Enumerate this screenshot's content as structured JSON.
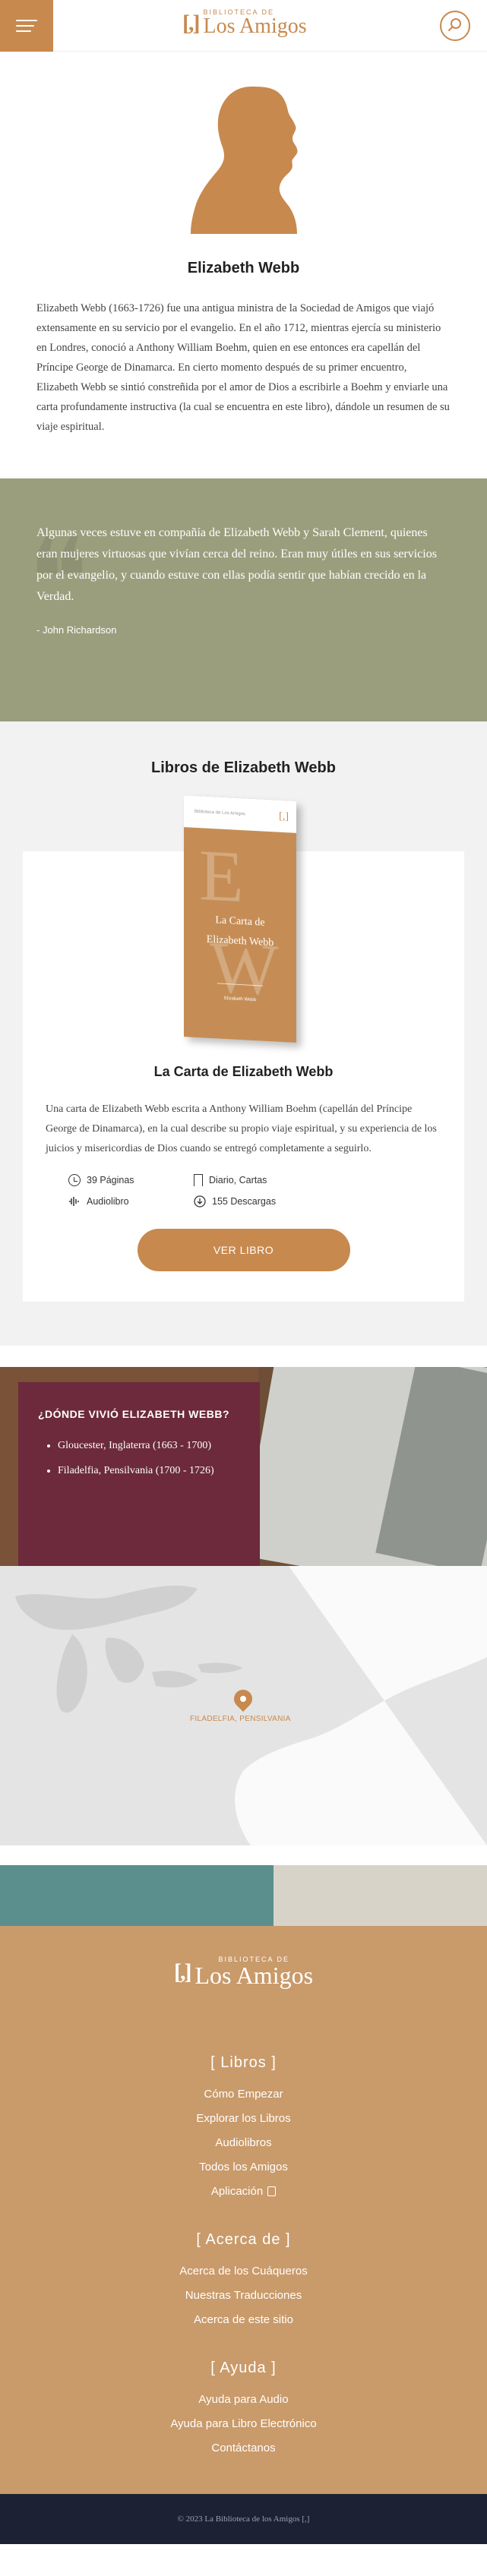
{
  "header": {
    "logo_mark": "[,]",
    "logo_small": "BIBLIOTECA DE",
    "logo_big": "Los Amigos"
  },
  "author": {
    "name": "Elizabeth Webb",
    "bio": "Elizabeth Webb (1663-1726) fue una antigua ministra de la Sociedad de Amigos que viajó extensamente en su servicio por el evangelio. En el año 1712, mientras ejercía su ministerio en Londres, conoció a Anthony William Boehm, quien en ese entonces era capellán del Príncipe George de Dinamarca. En cierto momento después de su primer encuentro, Elizabeth Webb se sintió constreñida por el amor de Dios a escribirle a Boehm y enviarle una carta profundamente instructiva (la cual se encuentra en este libro), dándole un resumen de su viaje espiritual."
  },
  "quote": {
    "text": "Algunas veces estuve en compañía de Elizabeth Webb y Sarah Clement, quienes eran mujeres virtuosas que vivían cerca del reino. Eran muy útiles en sus servicios por el evangelio, y cuando estuve con ellas podía sentir que habían crecido en la Verdad.",
    "author": "- John Richardson"
  },
  "books": {
    "section_title": "Libros de Elizabeth Webb",
    "cover": {
      "top_text": "Biblioteca de Los Amigos",
      "top_mark": "[,]",
      "letter_e": "E",
      "letter_w": "W",
      "title_line1": "La Carta de",
      "title_line2": "Elizabeth Webb",
      "author": "Elizabeth Webb"
    },
    "title": "La Carta de Elizabeth Webb",
    "description": "Una carta de Elizabeth Webb escrita a Anthony William Boehm (capellán del Príncipe George de Dinamarca), en la cual describe su propio viaje espiritual, y su experiencia de los juicios y misericordias de Dios cuando se entregó completamente a seguirlo.",
    "pages": "39 Páginas",
    "tags": "Diario, Cartas",
    "audio": "Audiolibro",
    "downloads": "155 Descargas",
    "button": "VER LIBRO"
  },
  "where": {
    "title": "¿DÓNDE VIVIÓ ELIZABETH WEBB?",
    "places": [
      "Gloucester, Inglaterra (1663 - 1700)",
      "Filadelfia, Pensilvania (1700 - 1726)"
    ]
  },
  "map": {
    "label": "FILADELFIA, PENSILVANIA"
  },
  "footer": {
    "logo_mark": "[,]",
    "logo_small": "BIBLIOTECA DE",
    "logo_big": "Los Amigos",
    "sections": [
      {
        "heading": "[ Libros ]",
        "links": [
          "Cómo Empezar",
          "Explorar los Libros",
          "Audiolibros",
          "Todos los Amigos",
          "Aplicación"
        ]
      },
      {
        "heading": "[ Acerca de ]",
        "links": [
          "Acerca de los Cuáqueros",
          "Nuestras Traducciones",
          "Acerca de este sitio"
        ]
      },
      {
        "heading": "[ Ayuda ]",
        "links": [
          "Ayuda para Audio",
          "Ayuda para Libro Electrónico",
          "Contáctanos"
        ]
      }
    ],
    "copyright": "© 2023 La Biblioteca de los Amigos [,]"
  }
}
